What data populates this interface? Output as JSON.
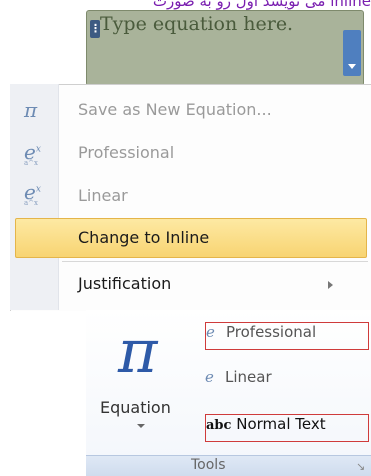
{
  "header_text": "می نویسد اول رو به صورت inline",
  "equation_field": {
    "placeholder": "Type equation here."
  },
  "context_menu": {
    "items": [
      {
        "label": "Save as New Equation...",
        "icon": "pi-save-icon",
        "enabled": false
      },
      {
        "label": "Professional",
        "icon": "professional-equation-icon",
        "enabled": false
      },
      {
        "label": "Linear",
        "icon": "linear-equation-icon",
        "enabled": false
      },
      {
        "label": "Change to Inline",
        "icon": "",
        "enabled": true,
        "highlighted": true
      },
      {
        "label": "Justification",
        "icon": "",
        "enabled": true,
        "has_submenu": true
      }
    ]
  },
  "ribbon": {
    "equation_label": "Equation",
    "professional_label": "Professional",
    "linear_label": "Linear",
    "normal_text_label": "Normal Text",
    "normal_text_icon_text": "abc",
    "group_label": "Tools"
  },
  "colors": {
    "highlight": "#f8d472",
    "equation_box": "#a9b39a",
    "pi": "#2e5aa8",
    "callout_border": "#cf3b3b"
  }
}
